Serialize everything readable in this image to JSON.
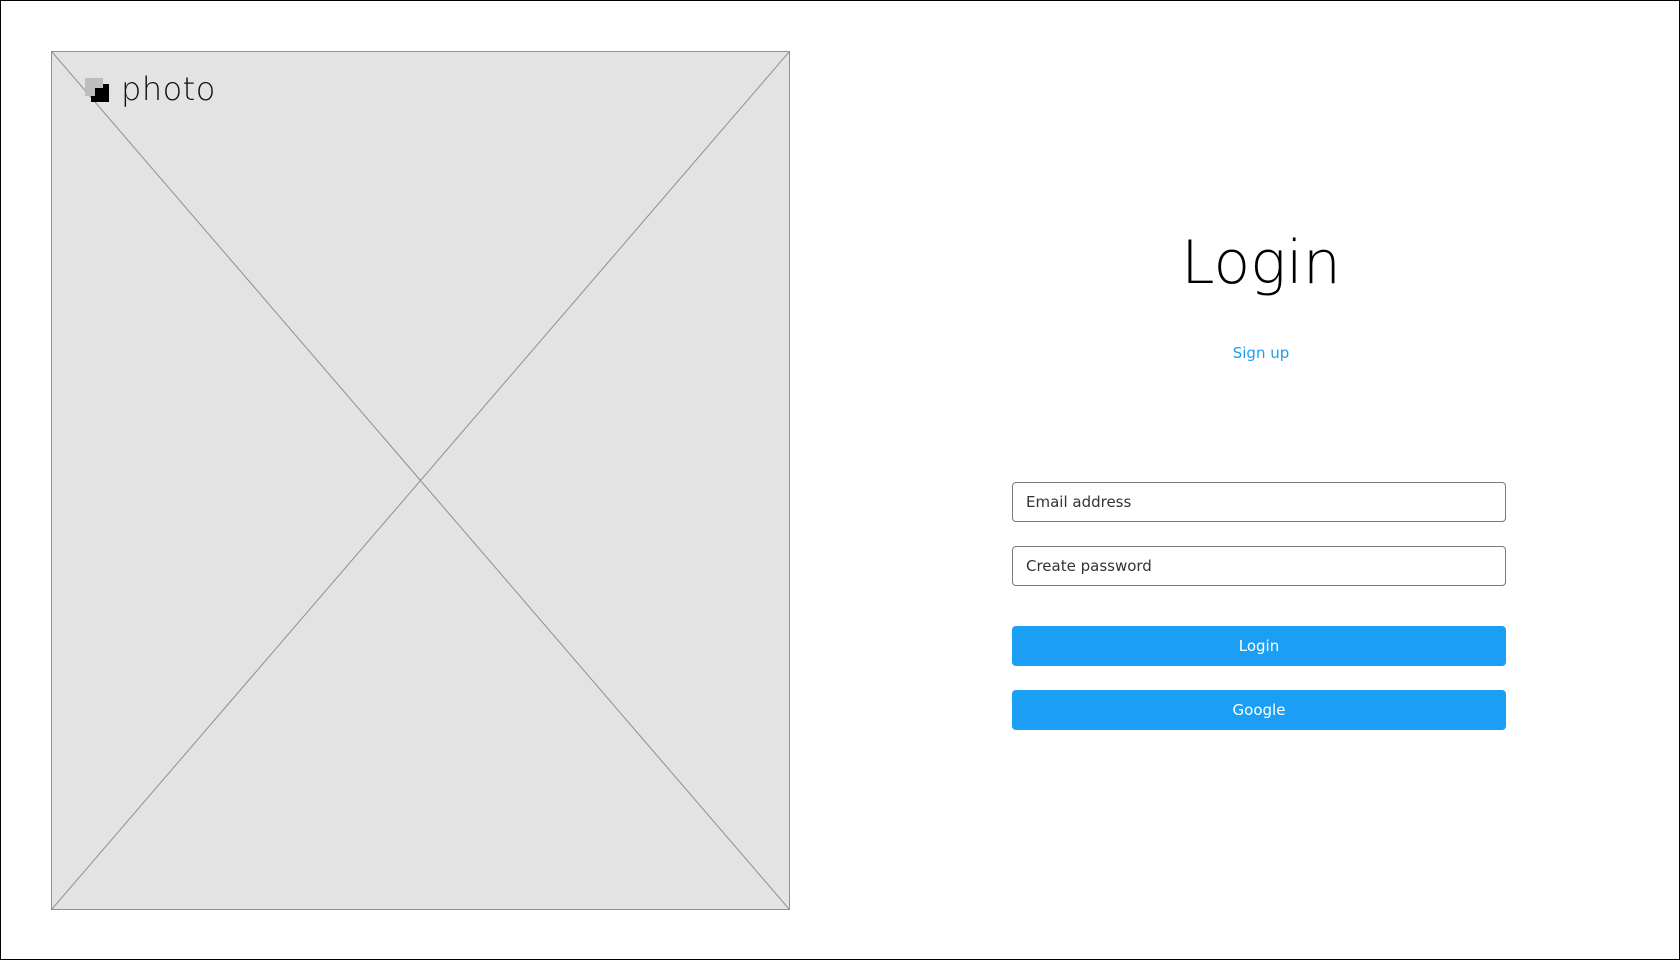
{
  "brand": {
    "name": "photo",
    "icon": "logo-square-icon"
  },
  "hero_image": {
    "icon": "image-placeholder-icon"
  },
  "login": {
    "title": "Login",
    "signup_link": "Sign up",
    "email_placeholder": "Email address",
    "password_placeholder": "Create password",
    "login_button": "Login",
    "google_button": "Google"
  },
  "colors": {
    "accent": "#1a9ff5",
    "placeholder_bg": "#e3e3e3",
    "placeholder_stroke": "#8f8f8f",
    "text": "#000000"
  }
}
